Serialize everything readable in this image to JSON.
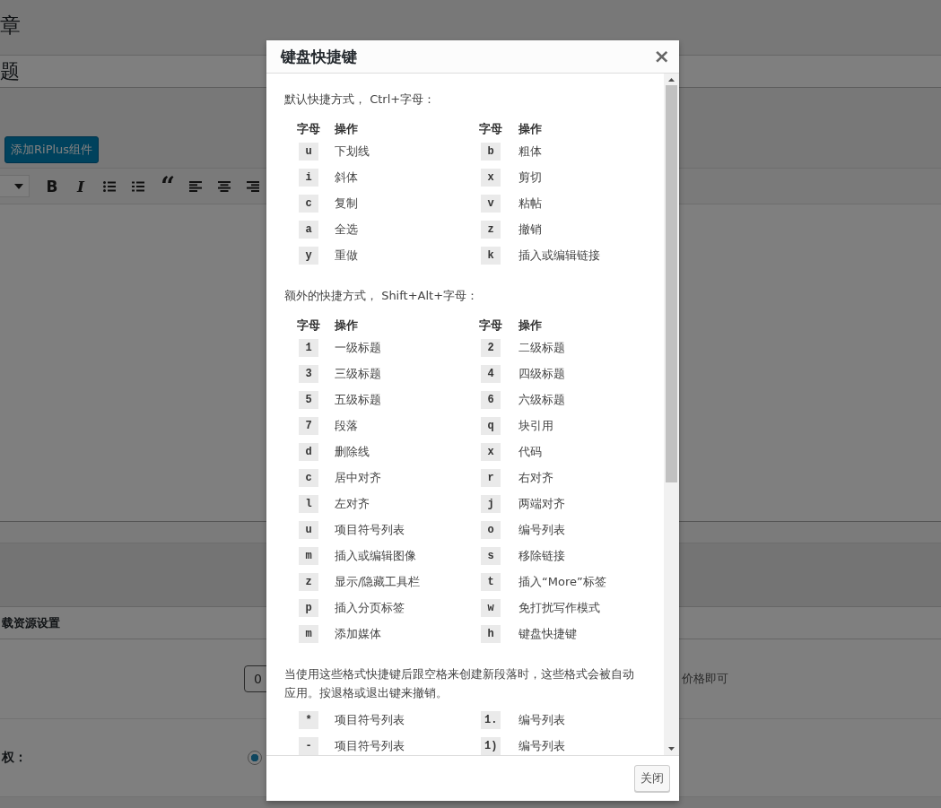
{
  "page": {
    "heading": "章",
    "title_field": "题",
    "add_button": "添加RiPlus组件",
    "toolbar": [
      {
        "kind": "dropdown"
      },
      {
        "kind": "bold",
        "glyph": "B"
      },
      {
        "kind": "italic",
        "glyph": "I"
      },
      {
        "kind": "bullets"
      },
      {
        "kind": "numbers"
      },
      {
        "kind": "quote",
        "glyph": "“"
      },
      {
        "kind": "align-left"
      },
      {
        "kind": "align-center"
      },
      {
        "kind": "align-right"
      }
    ],
    "section_title": "载资源设置",
    "price_value": "0",
    "price_hint": "价格即可",
    "option_label": "权：",
    "option_radio": {
      "selected": true
    }
  },
  "dialog": {
    "title": "键盘快捷键",
    "close": "×",
    "sections": [
      {
        "intro": "默认快捷方式， Ctrl+字母：",
        "columns": [
          "字母",
          "操作",
          "字母",
          "操作"
        ],
        "rows": [
          [
            "u",
            "下划线",
            "b",
            "粗体"
          ],
          [
            "i",
            "斜体",
            "x",
            "剪切"
          ],
          [
            "c",
            "复制",
            "v",
            "粘帖"
          ],
          [
            "a",
            "全选",
            "z",
            "撤销"
          ],
          [
            "y",
            "重做",
            "k",
            "插入或编辑链接"
          ]
        ]
      },
      {
        "intro": "额外的快捷方式， Shift+Alt+字母：",
        "columns": [
          "字母",
          "操作",
          "字母",
          "操作"
        ],
        "rows": [
          [
            "1",
            "一级标题",
            "2",
            "二级标题"
          ],
          [
            "3",
            "三级标题",
            "4",
            "四级标题"
          ],
          [
            "5",
            "五级标题",
            "6",
            "六级标题"
          ],
          [
            "7",
            "段落",
            "q",
            "块引用"
          ],
          [
            "d",
            "删除线",
            "x",
            "代码"
          ],
          [
            "c",
            "居中对齐",
            "r",
            "右对齐"
          ],
          [
            "l",
            "左对齐",
            "j",
            "两端对齐"
          ],
          [
            "u",
            "项目符号列表",
            "o",
            "编号列表"
          ],
          [
            "m",
            "插入或编辑图像",
            "s",
            "移除链接"
          ],
          [
            "z",
            "显示/隐藏工具栏",
            "t",
            "插入“More”标签"
          ],
          [
            "p",
            "插入分页标签",
            "w",
            "免打扰写作模式"
          ],
          [
            "m",
            "添加媒体",
            "h",
            "键盘快捷键"
          ]
        ]
      },
      {
        "intro": "当使用这些格式快捷键后跟空格来创建新段落时，这些格式会被自动应用。按退格或退出键来撤销。",
        "rows": [
          [
            "*",
            "项目符号列表",
            "1.",
            "编号列表"
          ],
          [
            "-",
            "项目符号列表",
            "1)",
            "编号列表"
          ]
        ]
      }
    ],
    "close_button": "关闭"
  }
}
